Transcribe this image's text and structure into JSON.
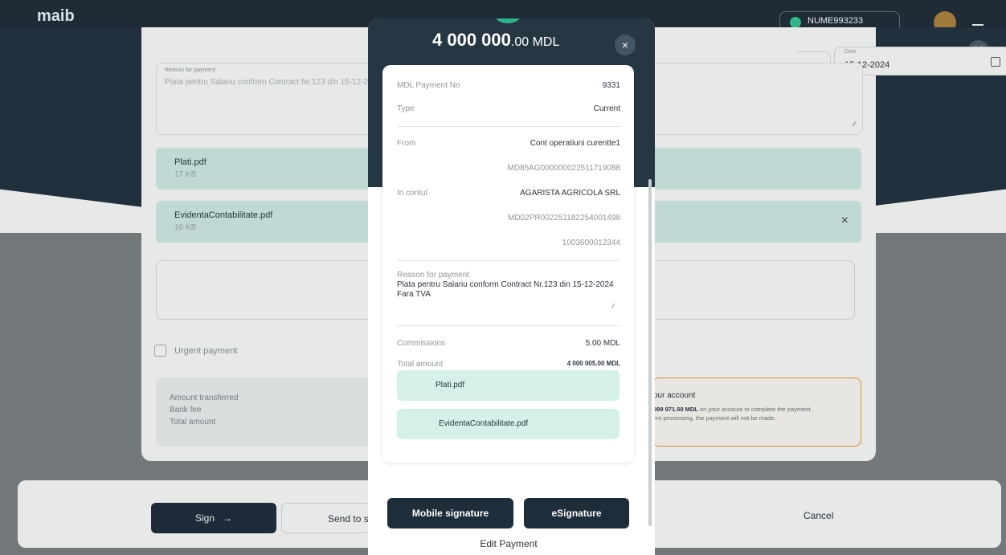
{
  "header": {
    "logo": "maib",
    "account_chip": "NUME993233"
  },
  "background_form": {
    "date_label": "Date",
    "date_value": "15-12-2024",
    "reason_label": "Reason for payment",
    "reason_value": "Plata pentru Salariu conform Contract Nr.123 din 15-12-2024",
    "files": [
      {
        "name": "Plati.pdf",
        "size": "17 KB"
      },
      {
        "name": "EvidentaContabilitate.pdf",
        "size": "16 KB"
      }
    ],
    "urgent_label": "Urgent payment",
    "summary": {
      "amount_transferred": "Amount transferred",
      "bank_fee": "Bank fee",
      "total_amount": "Total amount"
    },
    "warning": {
      "title": "our account",
      "line1_amount": "999 971.50 MDL",
      "line1_rest": " on your account to complete the payment.",
      "line2": "ent processing, the payment will not be made."
    },
    "buttons": {
      "sign": "Sign",
      "sign_arrow": "→",
      "send": "Send to s",
      "cancel": "Cancel"
    }
  },
  "modal": {
    "amount_main": "4 000 000",
    "amount_decimal": ".00 MDL",
    "close": "×",
    "details": {
      "payment_no_label": "MDL Payment No",
      "payment_no": "9331",
      "type_label": "Type",
      "type": "Current",
      "from_label": "From",
      "from_account": "Cont operatiuni curentte1",
      "from_iban": "MD85AG000000022511719088",
      "to_label": "In contul",
      "to_name": "AGARISTA AGRICOLA SRL",
      "to_iban": "MD02PR002251182254001498",
      "to_code": "1003600012344",
      "reason_label": "Reason for payment",
      "reason": "Plata pentru Salariu conform Contract Nr.123 din 15-12-2024 Fara TVA",
      "commissions_label": "Commissions",
      "commissions": "5.00 MDL",
      "total_label": "Total amount",
      "total": "4 000 005.00 MDL"
    },
    "files": [
      {
        "name": "Plati.pdf"
      },
      {
        "name": "EvidentaContabilitate.pdf"
      }
    ],
    "buttons": {
      "mobile_signature": "Mobile signature",
      "esignature": "eSignature",
      "edit": "Edit Payment"
    }
  }
}
